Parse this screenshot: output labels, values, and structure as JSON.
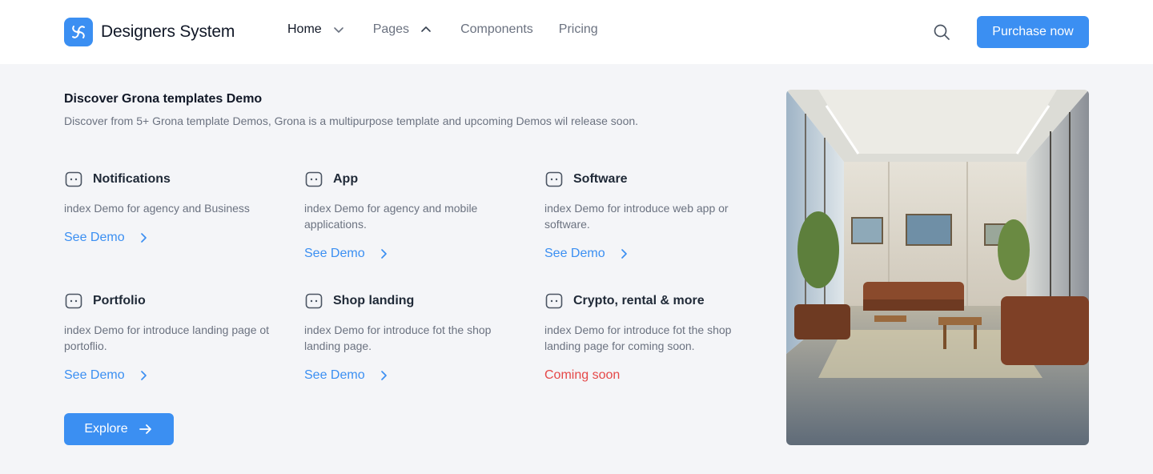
{
  "brand": {
    "name": "Designers System",
    "color": "#3b8ff2"
  },
  "nav": {
    "home": "Home",
    "pages": "Pages",
    "components": "Components",
    "pricing": "Pricing"
  },
  "header": {
    "purchase_label": "Purchase now"
  },
  "menu": {
    "title": "Discover Grona templates Demo",
    "description": "Discover from 5+ Grona template Demos, Grona is a multipurpose template and upcoming Demos wil release soon.",
    "cards": [
      {
        "title": "Notifications",
        "desc": "index Demo for agency and Business",
        "link": "See Demo"
      },
      {
        "title": "App",
        "desc": "index Demo for agency and mobile applications.",
        "link": "See Demo"
      },
      {
        "title": "Software",
        "desc": "index Demo for introduce web app or software.",
        "link": "See Demo"
      },
      {
        "title": "Portfolio",
        "desc": "index Demo for introduce landing page ot portoflio.",
        "link": "See Demo"
      },
      {
        "title": "Shop landing",
        "desc": "index Demo for introduce fot the shop landing page.",
        "link": "See Demo"
      },
      {
        "title": "Crypto, rental & more",
        "desc": "index Demo for introduce fot the shop landing page for coming soon.",
        "link": "Coming soon"
      }
    ],
    "explore_label": "Explore"
  },
  "colors": {
    "accent": "#3b8ff2",
    "coming_soon": "#e54848",
    "panel_bg": "#f4f5f8"
  },
  "icons": [
    "search-icon",
    "chevron-down-icon",
    "chevron-up-icon",
    "chat-bubble-icon",
    "chevron-right-icon",
    "arrow-right-icon"
  ]
}
